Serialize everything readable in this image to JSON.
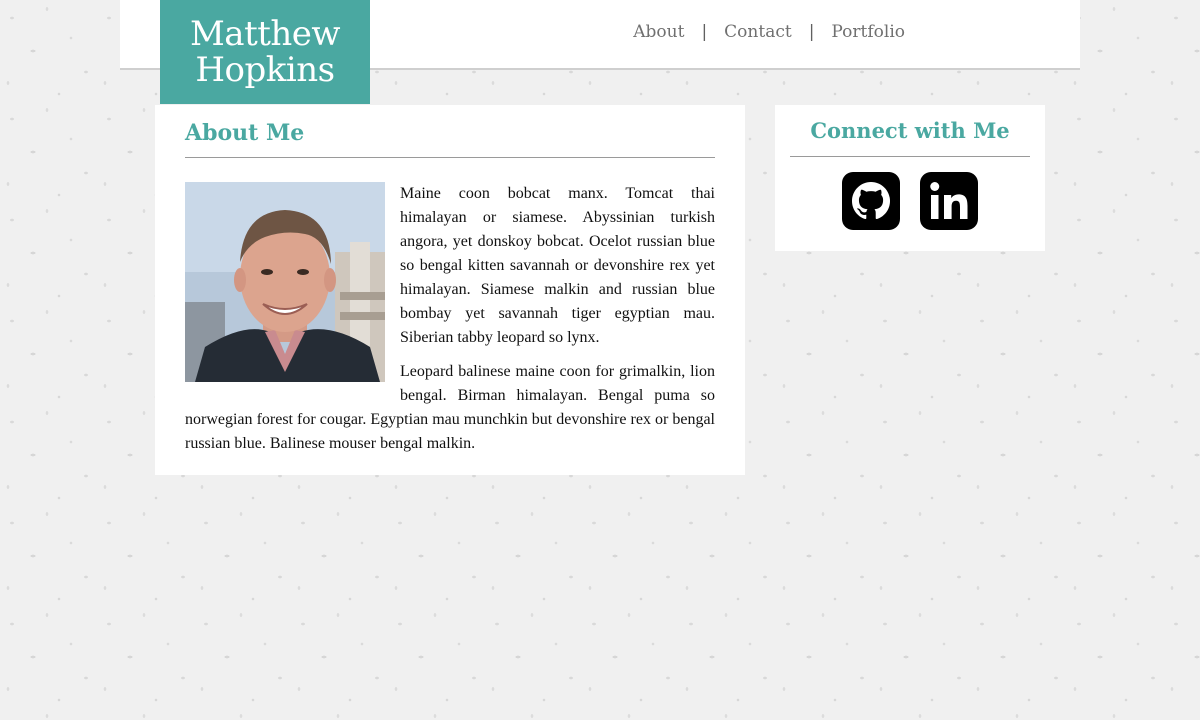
{
  "logo": {
    "line1": "Matthew",
    "line2": "Hopkins"
  },
  "nav": {
    "items": [
      {
        "label": "About"
      },
      {
        "label": "Contact"
      },
      {
        "label": "Portfolio"
      }
    ],
    "separator": "|"
  },
  "about": {
    "title": "About Me",
    "photo_icon": "profile-photo",
    "paragraphs": [
      "Maine coon bobcat manx. Tomcat thai himalayan or siamese. Abyssinian turkish angora, yet donskoy bobcat. Ocelot russian blue so bengal kitten savannah or devonshire rex yet himalayan. Siamese malkin and russian blue bombay yet savannah tiger egyptian mau. Siberian tabby leopard so lynx.",
      "Leopard balinese maine coon for grimalkin, lion bengal. Birman himalayan. Bengal puma so norwegian forest for cougar. Egyptian mau munchkin but devonshire rex or bengal russian blue. Balinese mouser bengal malkin."
    ]
  },
  "connect": {
    "title": "Connect with Me",
    "links": [
      {
        "icon": "github-icon"
      },
      {
        "icon": "linkedin-icon"
      }
    ]
  },
  "colors": {
    "accent": "#4aa8a1",
    "background": "#f0f0f0",
    "card": "#ffffff",
    "nav_text": "#707070"
  }
}
